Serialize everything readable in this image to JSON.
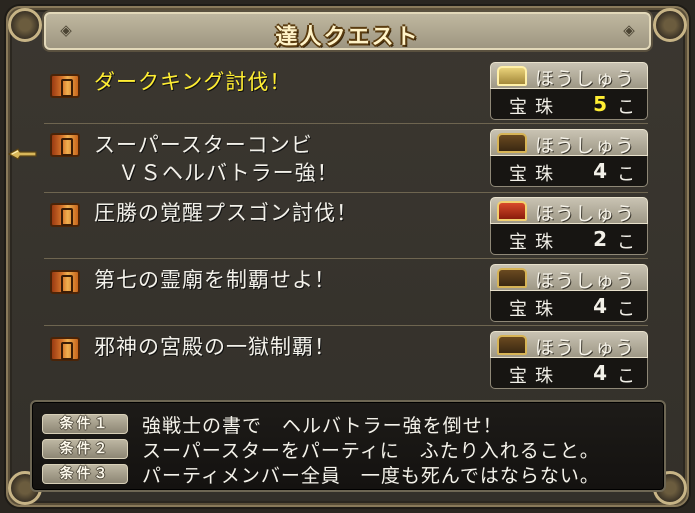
{
  "window": {
    "title": "達人クエスト"
  },
  "quests": [
    {
      "name_line1": "ダークキング討伐！",
      "name_line2": "",
      "reward_label": "ほうしゅう",
      "gem_label": "宝珠",
      "gem_count": "5",
      "gem_unit": "こ",
      "chest": "gold-chest-icon",
      "active": true
    },
    {
      "name_line1": "スーパースターコンビ",
      "name_line2": "ＶＳヘルバトラー強！",
      "reward_label": "ほうしゅう",
      "gem_label": "宝珠",
      "gem_count": "4",
      "gem_unit": "こ",
      "chest": "brown-chest-icon",
      "active": false
    },
    {
      "name_line1": "圧勝の覚醒プスゴン討伐！",
      "name_line2": "",
      "reward_label": "ほうしゅう",
      "gem_label": "宝珠",
      "gem_count": "2",
      "gem_unit": "こ",
      "chest": "red-chest-icon",
      "active": false
    },
    {
      "name_line1": "第七の霊廟を制覇せよ！",
      "name_line2": "",
      "reward_label": "ほうしゅう",
      "gem_label": "宝珠",
      "gem_count": "4",
      "gem_unit": "こ",
      "chest": "brown-chest-icon",
      "active": false
    },
    {
      "name_line1": "邪神の宮殿の一獄制覇！",
      "name_line2": "",
      "reward_label": "ほうしゅう",
      "gem_label": "宝珠",
      "gem_count": "4",
      "gem_unit": "こ",
      "chest": "brown-chest-icon",
      "active": false
    }
  ],
  "conditions": [
    {
      "badge": "条件１",
      "text": "強戦士の書で　ヘルバトラー強を倒せ！"
    },
    {
      "badge": "条件２",
      "text": "スーパースターをパーティに　ふたり入れること。"
    },
    {
      "badge": "条件３",
      "text": "パーティメンバー全員　一度も死んではならない。"
    }
  ],
  "colors": {
    "highlight": "#ffee33",
    "text": "#f3f1ea",
    "frame": "#8a7a5a"
  },
  "cursor": {
    "icon": "hand-pointer-icon",
    "selected_index": 1
  }
}
